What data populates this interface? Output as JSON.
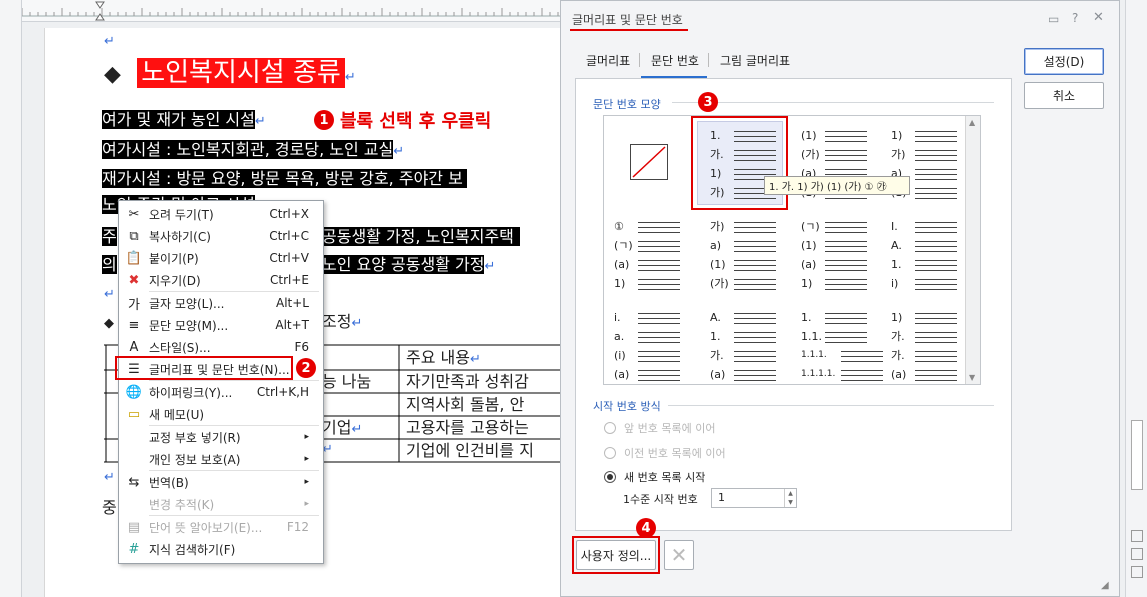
{
  "document": {
    "heading": "노인복지시설 종류",
    "lines": [
      "여가 및 재가 농인 시설",
      "여가시설 : 노인복지회관, 경로당, 노인 교실",
      "재가시설 : 방문 요양, 방문 목욕, 방문 강호, 주야간 보",
      "노인 주간 및 아고 시설",
      "주",
      "의",
      "공동생활 가정, 노인복지주택",
      "노인 요양 공동생활 가정"
    ],
    "section_text": "조정",
    "bottom_char": "중",
    "table": {
      "header": "주요 내용",
      "left_cells": [
        "능 나눔",
        "기업",
        ""
      ],
      "right_cells": [
        "자기만족과 성취감",
        "지역사회 돌봄, 안",
        "고용자를 고용하는",
        "기업에 인건비를 지"
      ]
    },
    "annotation1": "블록 선택 후 우클릭"
  },
  "context_menu": {
    "items": [
      {
        "icon": "scissors-icon",
        "glyph": "✂",
        "label": "오려 두기(T)",
        "shortcut": "Ctrl+X",
        "disabled": false
      },
      {
        "icon": "copy-icon",
        "glyph": "⧉",
        "label": "복사하기(C)",
        "shortcut": "Ctrl+C",
        "disabled": false
      },
      {
        "icon": "paste-icon",
        "glyph": "📋",
        "label": "붙이기(P)",
        "shortcut": "Ctrl+V",
        "disabled": false
      },
      {
        "icon": "delete-icon",
        "glyph": "✖",
        "label": "지우기(D)",
        "shortcut": "Ctrl+E",
        "disabled": false
      },
      {
        "icon": "char-shape-icon",
        "glyph": "가",
        "label": "글자 모양(L)...",
        "shortcut": "Alt+L",
        "disabled": false
      },
      {
        "icon": "para-shape-icon",
        "glyph": "≡",
        "label": "문단 모양(M)...",
        "shortcut": "Alt+T",
        "disabled": false
      },
      {
        "icon": "style-icon",
        "glyph": "A",
        "label": "스타일(S)...",
        "shortcut": "F6",
        "disabled": false
      },
      {
        "icon": "bullet-list-icon",
        "glyph": "☰",
        "label": "글머리표 및 문단 번호(N)...",
        "shortcut": "",
        "disabled": false
      },
      {
        "icon": "hyperlink-icon",
        "glyph": "🌐",
        "label": "하이퍼링크(Y)...",
        "shortcut": "Ctrl+K,H",
        "disabled": false
      },
      {
        "icon": "memo-icon",
        "glyph": "▭",
        "label": "새 메모(U)",
        "shortcut": "",
        "disabled": false
      },
      {
        "icon": "",
        "glyph": "",
        "label": "교정 부호 넣기(R)",
        "shortcut": "",
        "disabled": false,
        "submenu": true
      },
      {
        "icon": "",
        "glyph": "",
        "label": "개인 정보 보호(A)",
        "shortcut": "",
        "disabled": false,
        "submenu": true
      },
      {
        "icon": "translate-icon",
        "glyph": "⇆",
        "label": "번역(B)",
        "shortcut": "",
        "disabled": false,
        "submenu": true
      },
      {
        "icon": "",
        "glyph": "",
        "label": "변경 추적(K)",
        "shortcut": "",
        "disabled": true,
        "submenu": true
      },
      {
        "icon": "dictionary-icon",
        "glyph": "▤",
        "label": "단어 뜻 알아보기(E)...",
        "shortcut": "F12",
        "disabled": true
      },
      {
        "icon": "hashtag-icon",
        "glyph": "#",
        "label": "지식 검색하기(F)",
        "shortcut": "",
        "disabled": false
      }
    ]
  },
  "dialog": {
    "title": "글머리표 및 문단 번호",
    "tabs": [
      "글머리표",
      "문단 번호",
      "그림 글머리표"
    ],
    "active_tab": "문단 번호",
    "group1_title": "문단 번호 모양",
    "tooltip": "1. 가. 1) 가) (1) (가) ① ㉮",
    "number_styles": [
      [],
      [
        "1.",
        "가.",
        "1)",
        "가)"
      ],
      [
        "(1)",
        "(가)",
        "(a)",
        "(1)"
      ],
      [
        "1)",
        "가)",
        "a)",
        "(1)"
      ],
      [
        "①",
        "(ㄱ)",
        "(a)",
        "1)"
      ],
      [
        "가)",
        "a)",
        "(1)",
        "(가)"
      ],
      [
        "(ㄱ)",
        "(1)",
        "(a)",
        "1)"
      ],
      [
        "I.",
        "A.",
        "1.",
        "i)"
      ],
      [
        "i.",
        "a.",
        "(i)",
        "(a)"
      ],
      [
        "A.",
        "1.",
        "가.",
        "(a)"
      ],
      [
        "1.",
        "1.1.",
        "1.1.1.",
        "1.1.1.1."
      ],
      [
        "1)",
        "가.",
        "가.",
        "(a)"
      ]
    ],
    "group2_title": "시작 번호 방식",
    "radios": [
      {
        "label": "앞 번호 목록에 이어",
        "checked": false,
        "disabled": true
      },
      {
        "label": "이전 번호 목록에 이어",
        "checked": false,
        "disabled": true
      },
      {
        "label": "새 번호 목록 시작",
        "checked": true,
        "disabled": false
      }
    ],
    "start_label": "1수준 시작 번호",
    "start_value": "1",
    "ok_button": "설정(D)",
    "cancel_button": "취소",
    "custom_button": "사용자 정의...",
    "badges": [
      "1",
      "2",
      "3",
      "4"
    ]
  }
}
